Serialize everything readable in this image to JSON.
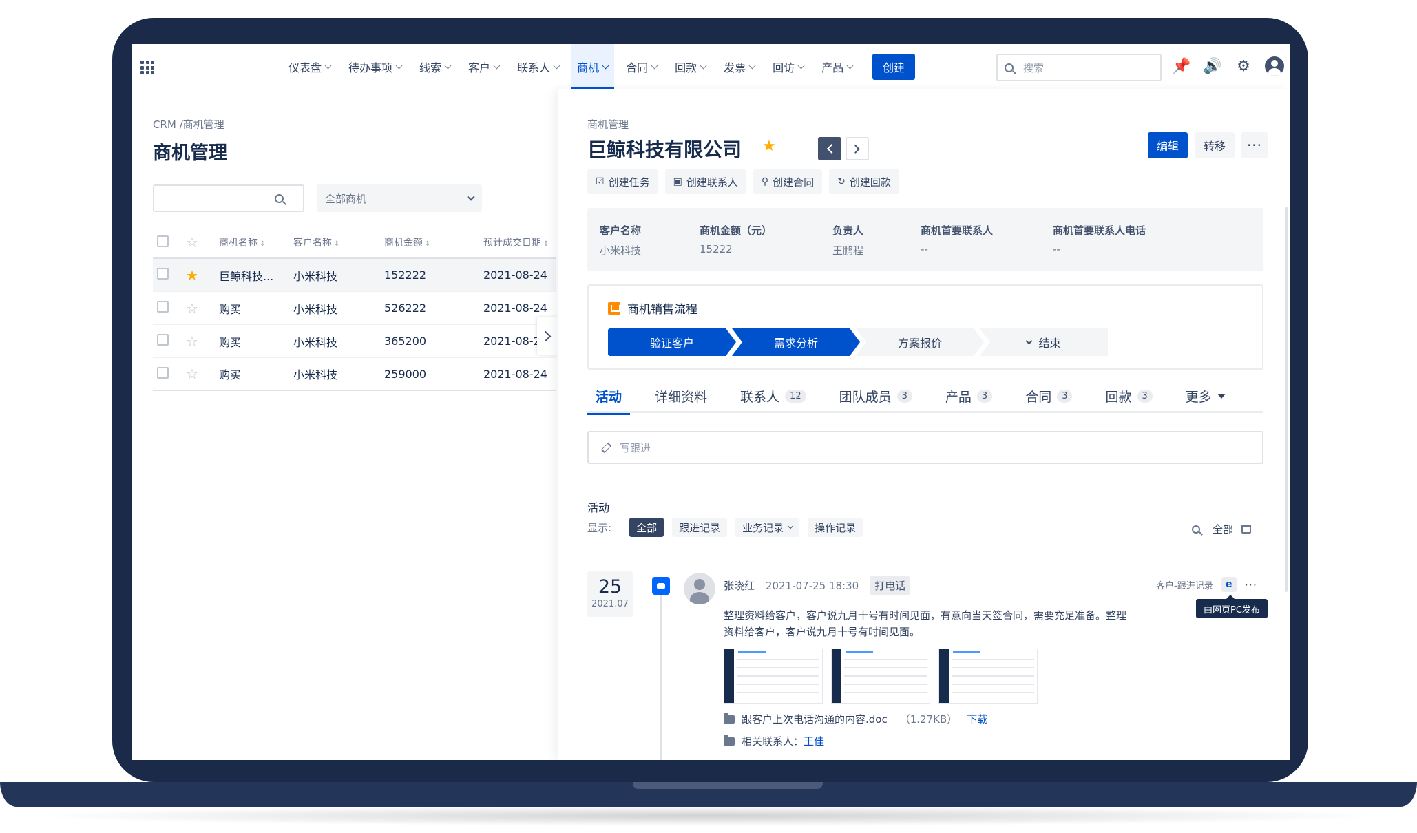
{
  "nav": {
    "items": [
      {
        "label": "仪表盘"
      },
      {
        "label": "待办事项"
      },
      {
        "label": "线索"
      },
      {
        "label": "客户"
      },
      {
        "label": "联系人"
      },
      {
        "label": "商机",
        "active": true
      },
      {
        "label": "合同"
      },
      {
        "label": "回款"
      },
      {
        "label": "发票"
      },
      {
        "label": "回访"
      },
      {
        "label": "产品"
      }
    ],
    "create_label": "创建",
    "search_placeholder": "搜索",
    "icons": [
      "apps-grid-icon",
      "pin-icon",
      "megaphone-icon",
      "gear-icon",
      "user-avatar-icon"
    ],
    "accent_color": "#0052cc"
  },
  "list": {
    "breadcrumb": "CRM /商机管理",
    "title": "商机管理",
    "filter_select": "全部商机",
    "columns": [
      "商机名称",
      "客户名称",
      "商机金额",
      "预计成交日期"
    ],
    "rows": [
      {
        "name": "巨鲸科技...",
        "customer": "小米科技",
        "amount": "152222",
        "date": "2021-08-24",
        "starred": true
      },
      {
        "name": "购买",
        "customer": "小米科技",
        "amount": "526222",
        "date": "2021-08-24",
        "starred": false
      },
      {
        "name": "购买",
        "customer": "小米科技",
        "amount": "365200",
        "date": "2021-08-24",
        "starred": false
      },
      {
        "name": "购买",
        "customer": "小米科技",
        "amount": "259000",
        "date": "2021-08-24",
        "starred": false
      }
    ]
  },
  "detail": {
    "breadcrumb": "商机管理",
    "title": "巨鲸科技有限公司",
    "edit_label": "编辑",
    "transfer_label": "转移",
    "more_label": "···",
    "actions": [
      "创建任务",
      "创建联系人",
      "创建合同",
      "创建回款"
    ],
    "summary": [
      {
        "label": "客户名称",
        "value": "小米科技"
      },
      {
        "label": "商机金额（元）",
        "value": "15222"
      },
      {
        "label": "负责人",
        "value": "王鹏程"
      },
      {
        "label": "商机首要联系人",
        "value": "--"
      },
      {
        "label": "商机首要联系人电话",
        "value": "--"
      }
    ],
    "process": {
      "title": "商机销售流程",
      "stages": [
        {
          "label": "验证客户",
          "done": true
        },
        {
          "label": "需求分析",
          "done": true
        },
        {
          "label": "方案报价",
          "done": false
        },
        {
          "label": "结束",
          "done": false
        }
      ]
    },
    "tabs": [
      {
        "label": "活动",
        "count": ""
      },
      {
        "label": "详细资料",
        "count": ""
      },
      {
        "label": "联系人",
        "count": "12"
      },
      {
        "label": "团队成员",
        "count": "3"
      },
      {
        "label": "产品",
        "count": "3"
      },
      {
        "label": "合同",
        "count": "3"
      },
      {
        "label": "回款",
        "count": "3"
      },
      {
        "label": "更多",
        "count": ""
      }
    ],
    "note_placeholder": "写跟进",
    "activity": {
      "heading": "活动",
      "filter_label": "显示:",
      "filters": [
        "全部",
        "跟进记录",
        "业务记录",
        "操作记录"
      ],
      "scope": "全部",
      "entry": {
        "day": "25",
        "year_month": "2021.07",
        "user": "张晓红",
        "datetime": "2021-07-25   18:30",
        "tag": "打电话",
        "source": "客户-跟进记录",
        "tooltip": "由网页PC发布",
        "text": "整理资料给客户，客户说九月十号有时间见面，有意向当天签合同，需要充足准备。整理资料给客户，客户说九月十号有时间见面。",
        "attachment": "跟客户上次电话沟通的内容.doc",
        "attachment_size": "（1.27KB）",
        "download_label": "下载",
        "related_label": "相关联系人：",
        "related_value": "王佳"
      }
    }
  }
}
